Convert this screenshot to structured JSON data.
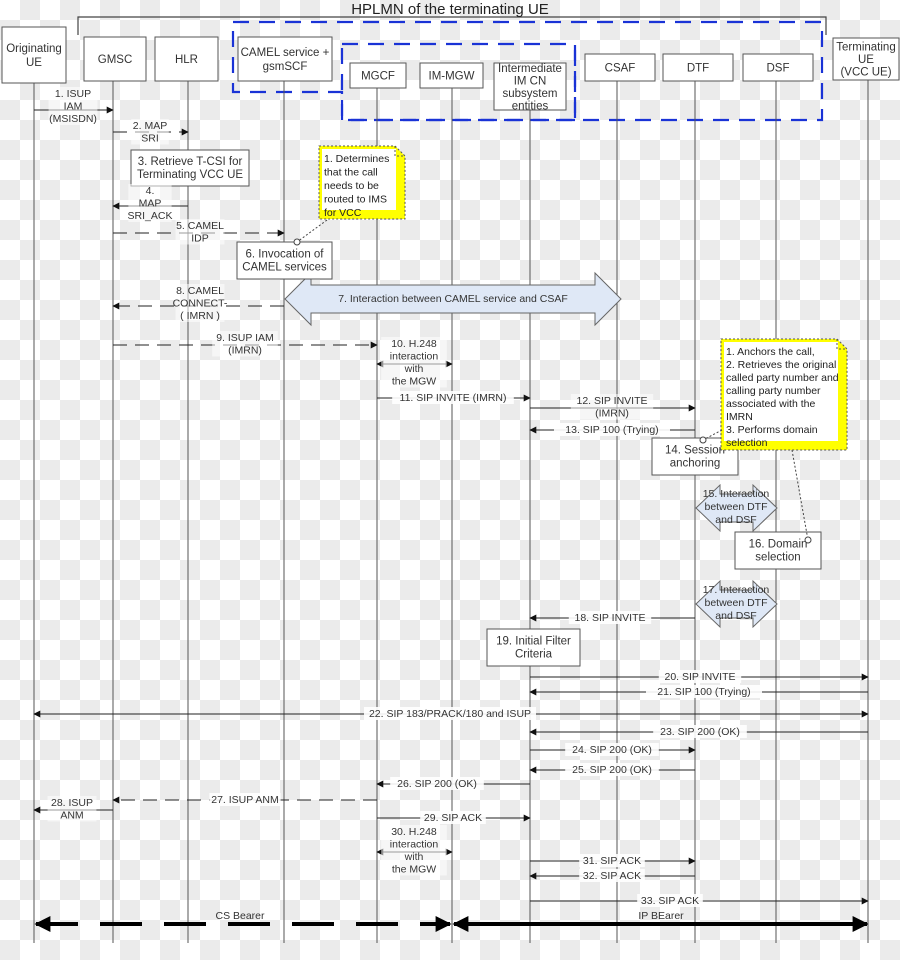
{
  "title": "HPLMN of the terminating UE",
  "colors": {
    "line": "#555555",
    "dash_region": "#1a33d6",
    "note_fill": "#ffff00",
    "note_inner": "#ffffff",
    "big_arrow_fill": "#dfe8f6",
    "bearer": "#000000"
  },
  "participants": [
    {
      "id": "ue_o",
      "lines": [
        "Originating",
        "UE"
      ]
    },
    {
      "id": "gmsc",
      "lines": [
        "GMSC"
      ]
    },
    {
      "id": "hlr",
      "lines": [
        "HLR"
      ]
    },
    {
      "id": "camel",
      "lines": [
        "CAMEL service +",
        "gsmSCF"
      ]
    },
    {
      "id": "mgcf",
      "lines": [
        "MGCF"
      ]
    },
    {
      "id": "imgw",
      "lines": [
        "IM-MGW"
      ]
    },
    {
      "id": "imcn",
      "lines": [
        "Intermediate",
        "IM CN",
        "subsystem",
        "entities"
      ]
    },
    {
      "id": "csaf",
      "lines": [
        "CSAF"
      ]
    },
    {
      "id": "dtf",
      "lines": [
        "DTF"
      ]
    },
    {
      "id": "dsf",
      "lines": [
        "DSF"
      ]
    },
    {
      "id": "ue_t",
      "lines": [
        "Terminating",
        "UE",
        "(VCC UE)"
      ]
    }
  ],
  "messages": [
    {
      "n": 1,
      "from": "ue_o",
      "to": "gmsc",
      "style": "solid",
      "lines": [
        "1. ISUP",
        "IAM",
        "(MSISDN)"
      ]
    },
    {
      "n": 2,
      "from": "gmsc",
      "to": "hlr",
      "style": "dashed",
      "lines": [
        "2. MAP",
        "SRI"
      ]
    },
    {
      "n": 4,
      "from": "hlr",
      "to": "gmsc",
      "style": "solid",
      "lines": [
        "4.",
        "MAP",
        "SRI_ACK"
      ]
    },
    {
      "n": 5,
      "from": "gmsc",
      "to": "camel",
      "style": "dashed",
      "lines": [
        "5. CAMEL",
        "IDP"
      ]
    },
    {
      "n": 8,
      "from": "camel",
      "to": "gmsc",
      "style": "dashed",
      "lines": [
        "8. CAMEL",
        "CONNECT-",
        "( IMRN )"
      ]
    },
    {
      "n": 9,
      "from": "gmsc",
      "to": "mgcf",
      "style": "dashed",
      "lines": [
        "9. ISUP IAM",
        "(IMRN)"
      ]
    },
    {
      "n": 10,
      "from": "mgcf",
      "to": "imgw",
      "style": "both",
      "lines": [
        "10. H.248",
        "interaction",
        "with",
        "the MGW"
      ]
    },
    {
      "n": 11,
      "from": "mgcf",
      "to": "imcn",
      "style": "solid",
      "lines": [
        "11. SIP INVITE (IMRN)"
      ]
    },
    {
      "n": 12,
      "from": "imcn",
      "to": "dtf",
      "style": "solid",
      "lines": [
        "12. SIP INVITE",
        "(IMRN)"
      ]
    },
    {
      "n": 13,
      "from": "dtf",
      "to": "imcn",
      "style": "solid",
      "lines": [
        "13. SIP 100 (Trying)"
      ]
    },
    {
      "n": 18,
      "from": "dtf",
      "to": "imcn",
      "style": "solid",
      "lines": [
        "18. SIP INVITE"
      ]
    },
    {
      "n": 20,
      "from": "imcn",
      "to": "ue_t",
      "style": "solid",
      "lines": [
        "20. SIP INVITE"
      ]
    },
    {
      "n": 21,
      "from": "ue_t",
      "to": "imcn",
      "style": "solid",
      "lines": [
        "21. SIP 100 (Trying)"
      ]
    },
    {
      "n": 22,
      "from": "ue_o",
      "to": "ue_t",
      "style": "both",
      "lines": [
        "22. SIP 183/PRACK/180 and ISUP"
      ]
    },
    {
      "n": 23,
      "from": "ue_t",
      "to": "imcn",
      "style": "solid",
      "lines": [
        "23. SIP 200 (OK)"
      ]
    },
    {
      "n": 24,
      "from": "imcn",
      "to": "dtf",
      "style": "solid",
      "lines": [
        "24. SIP 200 (OK)"
      ]
    },
    {
      "n": 25,
      "from": "dtf",
      "to": "imcn",
      "style": "solid",
      "lines": [
        "25. SIP 200 (OK)"
      ]
    },
    {
      "n": 26,
      "from": "imcn",
      "to": "mgcf",
      "style": "solid",
      "lines": [
        "26. SIP 200 (OK)"
      ]
    },
    {
      "n": 27,
      "from": "mgcf",
      "to": "gmsc",
      "style": "dashed",
      "lines": [
        "27. ISUP ANM"
      ]
    },
    {
      "n": 28,
      "from": "gmsc",
      "to": "ue_o",
      "style": "solid",
      "lines": [
        "28. ISUP",
        "ANM"
      ]
    },
    {
      "n": 29,
      "from": "mgcf",
      "to": "imcn",
      "style": "solid",
      "lines": [
        "29. SIP ACK"
      ]
    },
    {
      "n": 30,
      "from": "mgcf",
      "to": "imgw",
      "style": "both",
      "lines": [
        "30. H.248",
        "interaction",
        "with",
        "the MGW"
      ]
    },
    {
      "n": 31,
      "from": "imcn",
      "to": "dtf",
      "style": "solid",
      "lines": [
        "31. SIP ACK"
      ]
    },
    {
      "n": 32,
      "from": "dtf",
      "to": "imcn",
      "style": "solid",
      "lines": [
        "32. SIP ACK"
      ]
    },
    {
      "n": 33,
      "from": "imcn",
      "to": "ue_t",
      "style": "solid",
      "lines": [
        "33. SIP ACK"
      ]
    }
  ],
  "process_boxes": [
    {
      "n": 3,
      "lines": [
        "3. Retrieve T-CSI for",
        "Terminating VCC UE"
      ]
    },
    {
      "n": 6,
      "lines": [
        "6. Invocation of",
        "CAMEL services"
      ]
    },
    {
      "n": 14,
      "lines": [
        "14. Session",
        "anchoring"
      ]
    },
    {
      "n": 16,
      "lines": [
        "16. Domain",
        "selection"
      ]
    },
    {
      "n": 19,
      "lines": [
        "19. Initial Filter",
        "Criteria"
      ]
    }
  ],
  "interactions": [
    {
      "n": 7,
      "lines": [
        "7. Interaction between CAMEL service and CSAF"
      ]
    },
    {
      "n": 15,
      "lines": [
        "15. Interaction",
        "between DTF",
        "and DSF"
      ]
    },
    {
      "n": 17,
      "lines": [
        "17. Interaction",
        "between DTF",
        "and DSF"
      ]
    }
  ],
  "notes": [
    {
      "id": "camel_note",
      "lines": [
        "1. Determines",
        "that the call",
        "needs to be",
        "routed to IMS",
        "for VCC"
      ]
    },
    {
      "id": "vcc_note",
      "lines": [
        "1. Anchors the call,",
        "2. Retrieves the original",
        "called party number and",
        "calling party number",
        "associated with the",
        "IMRN",
        "3. Performs domain",
        "selection"
      ]
    }
  ],
  "bearers": [
    {
      "id": "cs",
      "label": "CS Bearer"
    },
    {
      "id": "ip",
      "label": "IP BEarer"
    }
  ]
}
